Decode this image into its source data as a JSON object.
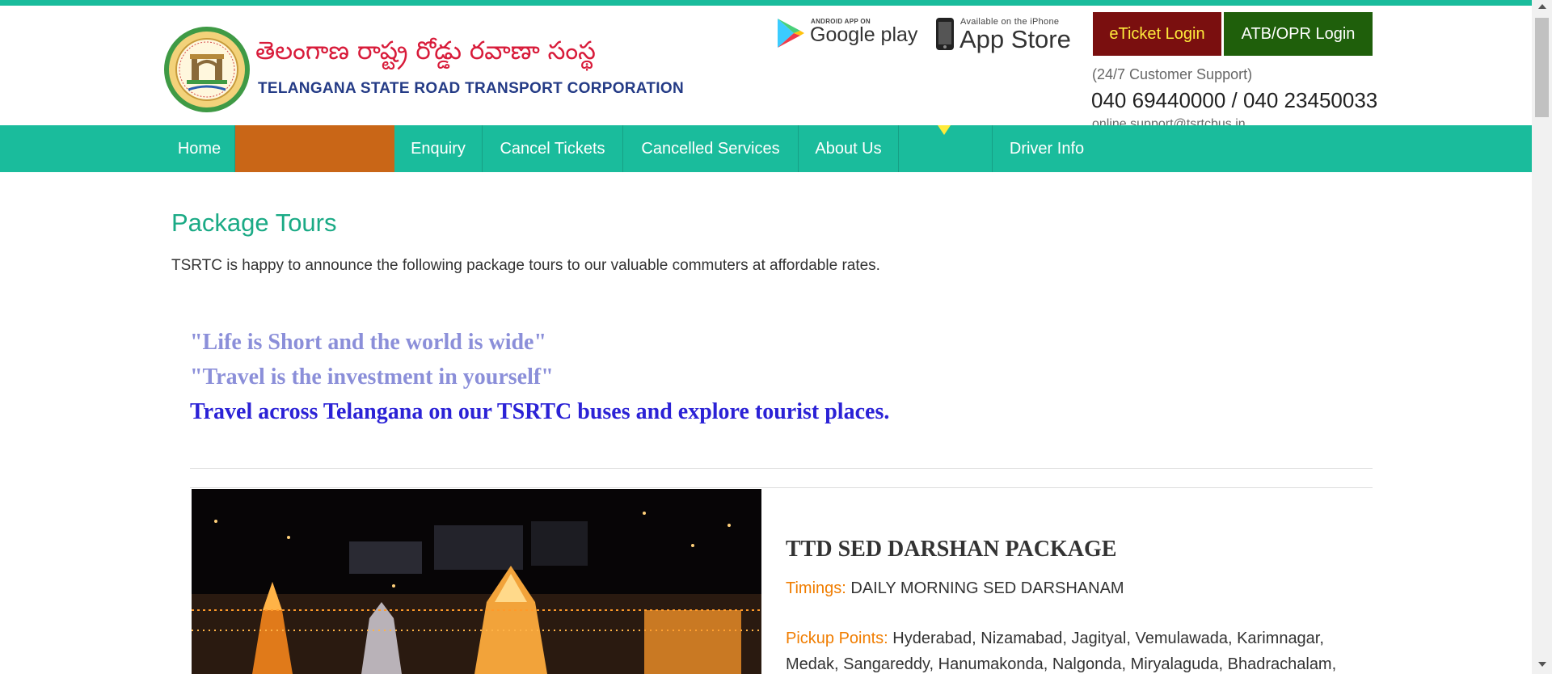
{
  "colors": {
    "brand_green": "#1abc9c",
    "title_green": "#1aaa85",
    "menu_orange": "#c96617",
    "eticket_bg": "#7a0f0f",
    "eticket_text": "#ffeb3b",
    "atb_bg": "#1f5f0b",
    "label_orange": "#f07d00",
    "quote_light": "#8b8fd9",
    "quote_dark": "#2b22d6"
  },
  "header": {
    "brand_telugu": "తెలంగాణ  రాష్ట్ర రోడ్డు రవాణా సంస్థ",
    "brand_english": "TELANGANA STATE ROAD TRANSPORT CORPORATION",
    "logo_icon": "tsrtc-emblem-icon",
    "google_play": {
      "small": "ANDROID APP ON",
      "big": "Google play",
      "icon": "google-play-icon"
    },
    "app_store": {
      "small": "Available on the iPhone",
      "big": "App Store",
      "icon": "iphone-icon"
    },
    "eticket_login": "eTicket Login",
    "atb_login": "ATB/OPR Login",
    "support_label": "(24/7 Customer Support)",
    "support_phone": "040 69440000 / 040 23450033",
    "support_email": "online.support@tsrtcbus.in"
  },
  "nav": {
    "home": "Home",
    "blank1": "",
    "enquiry": "Enquiry",
    "cancel_tickets": "Cancel Tickets",
    "cancelled_services": "Cancelled Services",
    "about_us": "About Us",
    "blank2": "",
    "driver_info": "Driver Info"
  },
  "main": {
    "title": "Package Tours",
    "intro": "TSRTC is happy to announce the following package tours to our valuable commuters at affordable rates.",
    "quote1": "\"Life is Short and the world is wide\"",
    "quote2": "\"Travel is the investment in yourself\"",
    "quote3": "Travel across Telangana on our TSRTC buses and explore tourist places."
  },
  "tour": {
    "title": "TTD SED DARSHAN PACKAGE",
    "timings_label": "Timings:",
    "timings_value": "DAILY MORNING SED DARSHANAM",
    "pickup_label": "Pickup Points:",
    "pickup_line1": "Hyderabad, Nizamabad, Jagityal, Vemulawada, Karimnagar,",
    "pickup_line2": "Medak, Sangareddy, Hanumakonda, Nalgonda, Miryalaguda, Bhadrachalam,"
  }
}
